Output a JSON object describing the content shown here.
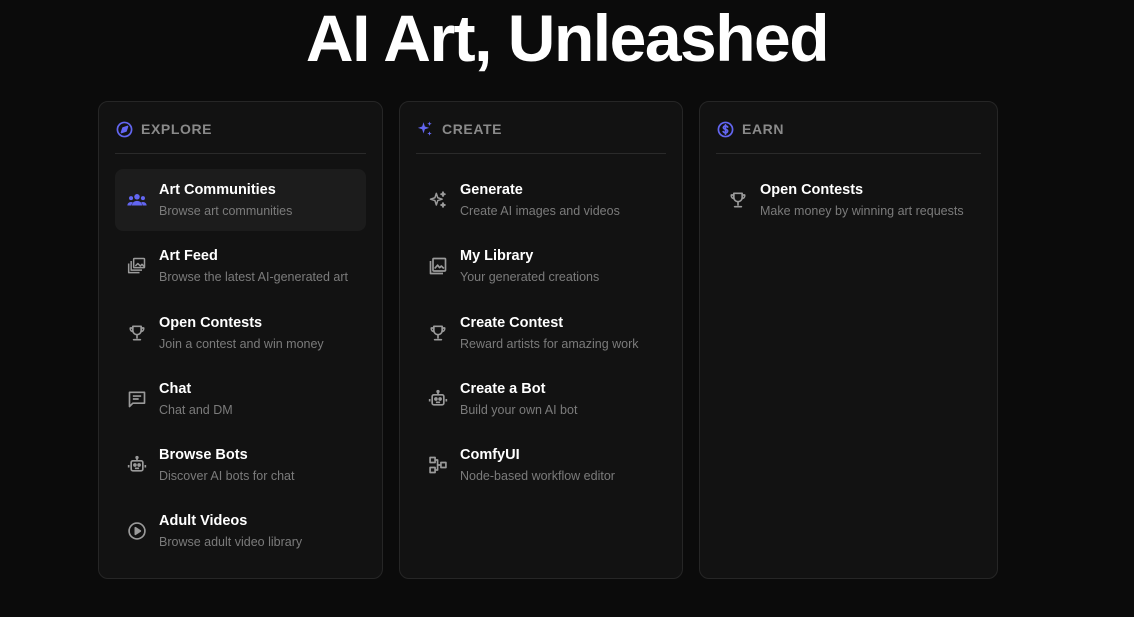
{
  "hero": {
    "title": "AI Art, Unleashed"
  },
  "colors": {
    "accent": "#6366f1",
    "icon_gray": "#9a9a9a",
    "muted_text": "#7b7b7b"
  },
  "explore": {
    "title": "EXPLORE",
    "icon": "compass-icon",
    "items": [
      {
        "title": "Art Communities",
        "desc": "Browse art communities",
        "icon": "users-icon"
      },
      {
        "title": "Art Feed",
        "desc": "Browse the latest AI-generated art",
        "icon": "gallery-stack-icon"
      },
      {
        "title": "Open Contests",
        "desc": "Join a contest and win money",
        "icon": "trophy-icon"
      },
      {
        "title": "Chat",
        "desc": "Chat and DM",
        "icon": "chat-icon"
      },
      {
        "title": "Browse Bots",
        "desc": "Discover AI bots for chat",
        "icon": "robot-icon"
      },
      {
        "title": "Adult Videos",
        "desc": "Browse adult video library",
        "icon": "play-circle-icon"
      }
    ]
  },
  "create": {
    "title": "CREATE",
    "icon": "sparkles-icon",
    "items": [
      {
        "title": "Generate",
        "desc": "Create AI images and videos",
        "icon": "sparkles-icon"
      },
      {
        "title": "My Library",
        "desc": "Your generated creations",
        "icon": "image-library-icon"
      },
      {
        "title": "Create Contest",
        "desc": "Reward artists for amazing work",
        "icon": "trophy-icon"
      },
      {
        "title": "Create a Bot",
        "desc": "Build your own AI bot",
        "icon": "robot-icon"
      },
      {
        "title": "ComfyUI",
        "desc": "Node-based workflow editor",
        "icon": "workflow-icon"
      }
    ]
  },
  "earn": {
    "title": "EARN",
    "icon": "dollar-circle-icon",
    "items": [
      {
        "title": "Open Contests",
        "desc": "Make money by winning art requests",
        "icon": "trophy-icon"
      }
    ]
  }
}
